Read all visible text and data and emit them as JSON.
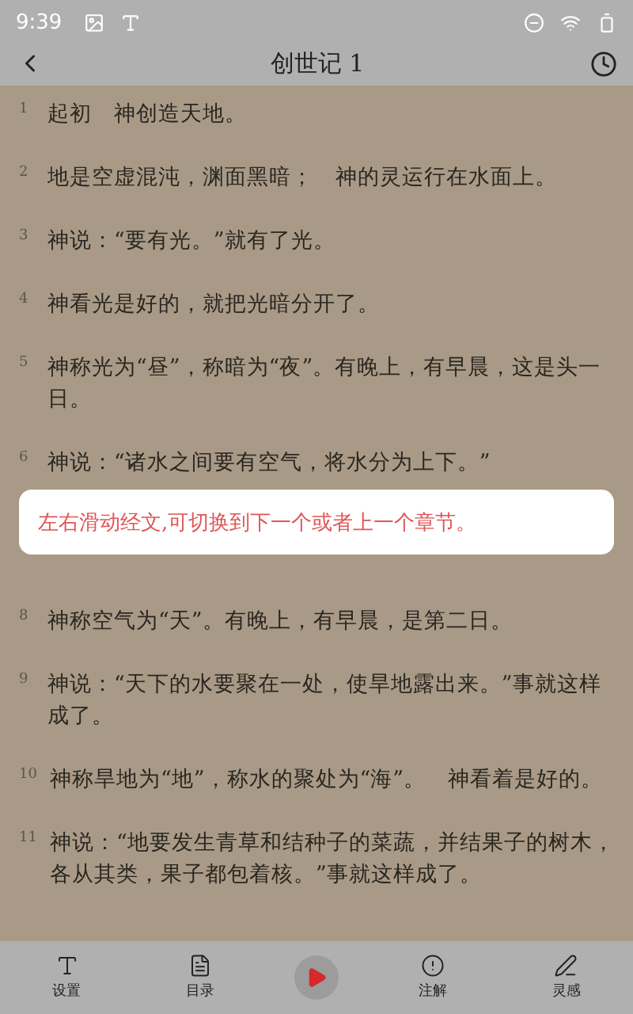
{
  "status_bar": {
    "time": "9:39"
  },
  "header": {
    "title": "创世记 1"
  },
  "verses": [
    {
      "kind": "verse",
      "number": "1",
      "text": "起初　神创造天地。"
    },
    {
      "kind": "verse",
      "number": "2",
      "text": "地是空虚混沌，渊面黑暗；　神的灵运行在水面上。"
    },
    {
      "kind": "verse",
      "number": "3",
      "text": "神说：“要有光。”就有了光。"
    },
    {
      "kind": "verse",
      "number": "4",
      "text": "神看光是好的，就把光暗分开了。"
    },
    {
      "kind": "verse",
      "number": "5",
      "text": "神称光为“昼”，称暗为“夜”。有晚上，有早晨，这是头一日。"
    },
    {
      "kind": "verse",
      "number": "6",
      "text": "神说：“诸水之间要有空气，将水分为上下。”"
    },
    {
      "kind": "covered"
    },
    {
      "kind": "verse",
      "number": "8",
      "text": "神称空气为“天”。有晚上，有早晨，是第二日。"
    },
    {
      "kind": "verse",
      "number": "9",
      "text": "神说：“天下的水要聚在一处，使旱地露出来。”事就这样成了。"
    },
    {
      "kind": "verse",
      "number": "10",
      "text": "神称旱地为“地”，称水的聚处为“海”。　神看着是好的。"
    },
    {
      "kind": "verse",
      "number": "11",
      "text": "神说：“地要发生青草和结种子的菜蔬，并结果子的树木，各从其类，果子都包着核。”事就这样成了。"
    }
  ],
  "toast": {
    "text": "左右滑动经文,可切换到下一个或者上一个章节。"
  },
  "bottom_nav": [
    {
      "kind": "tab",
      "label": "设置"
    },
    {
      "kind": "tab",
      "label": "目录"
    },
    {
      "kind": "play"
    },
    {
      "kind": "tab",
      "label": "注解"
    },
    {
      "kind": "tab",
      "label": "灵感"
    }
  ]
}
